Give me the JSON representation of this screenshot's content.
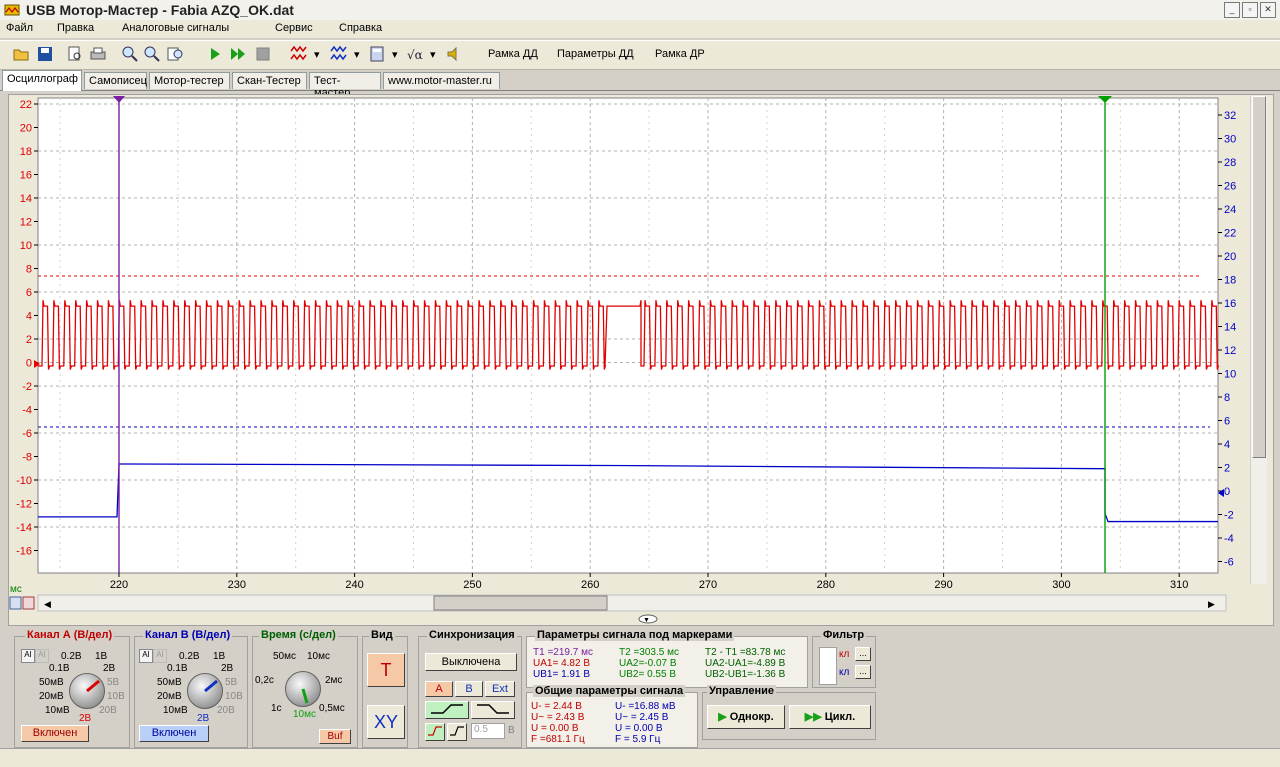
{
  "window": {
    "title": "USB Мотор-Мастер - Fabia AZQ_OK.dat",
    "controls": [
      "_",
      "▫",
      "✕"
    ]
  },
  "menu": [
    "Файл",
    "Правка",
    "Аналоговые сигналы",
    "Сервис",
    "Справка"
  ],
  "toolbar": {
    "frame_dd": "Рамка ДД",
    "params_dd": "Параметры ДД",
    "frame_dr": "Рамка ДР"
  },
  "tabs": [
    "Осциллограф",
    "Самописец",
    "Мотор-тестер",
    "Скан-Тестер",
    "Тест-мастер",
    "www.motor-master.ru"
  ],
  "scope": {
    "left_axis": [
      "22",
      "20",
      "18",
      "16",
      "14",
      "12",
      "10",
      "8",
      "6",
      "4",
      "2",
      "0",
      "-2",
      "-4",
      "-6",
      "-8",
      "-10",
      "-12",
      "-14",
      "-16"
    ],
    "right_axis": [
      "32",
      "30",
      "28",
      "26",
      "24",
      "22",
      "20",
      "18",
      "16",
      "14",
      "12",
      "10",
      "8",
      "6",
      "4",
      "2",
      "0",
      "-2",
      "-4",
      "-6"
    ],
    "time_axis": [
      "220",
      "230",
      "240",
      "250",
      "260",
      "270",
      "280",
      "290",
      "300",
      "310"
    ],
    "time_unit": "мс",
    "colors": {
      "chA": "#e00000",
      "chB": "#0000c8",
      "marker1": "#7a1fa0",
      "marker2": "#00a000"
    }
  },
  "chanA": {
    "title": "Канал А (В/дел)",
    "scales": [
      "0.2В",
      "1В",
      "0.1В",
      "2В",
      "50мВ",
      "5В",
      "20мВ",
      "10В",
      "10мВ",
      "20В"
    ],
    "current": "2В",
    "state": "Включен"
  },
  "chanB": {
    "title": "Канал В (В/дел)",
    "scales": [
      "0.2В",
      "1В",
      "0.1В",
      "2В",
      "50мВ",
      "5В",
      "20мВ",
      "10В",
      "10мВ",
      "20В"
    ],
    "current": "2В",
    "state": "Включен"
  },
  "time": {
    "title": "Время (с/дел)",
    "scales": [
      "50мс",
      "10мс",
      "0,2с",
      "2мс",
      "1с",
      "0,5мс"
    ],
    "current": "10мс",
    "buf": "Buf"
  },
  "view": {
    "title": "Вид",
    "t": "T",
    "xy": "XY"
  },
  "sync": {
    "title": "Синхронизация",
    "off": "Выключена",
    "a": "A",
    "b": "B",
    "ext": "Ext",
    "level": "0.5",
    "unit": "В"
  },
  "marker_params": {
    "title": "Параметры сигнала под маркерами",
    "col1": [
      "T1 =219.7 мс",
      "UA1= 4.82 В",
      "UB1= 1.91 В"
    ],
    "col2": [
      "T2 =303.5 мс",
      "UA2=-0.07 В",
      "UB2= 0.55 В"
    ],
    "col3": [
      "T2 - T1 =83.78 мс",
      "UA2-UA1=-4.89 В",
      "UB2-UB1=-1.36 В"
    ]
  },
  "general_params": {
    "title": "Общие параметры сигнала",
    "colA": [
      "U- = 2.44 В",
      "U~ = 2.43 В",
      "U = 0.00 В",
      "F =681.1 Гц"
    ],
    "colB": [
      "U- =16.88 мВ",
      "U~ = 2.45 В",
      "U = 0.00 В",
      "F = 5.9 Гц"
    ]
  },
  "filter": {
    "title": "Фильтр",
    "k1": "кл",
    "k2": "кл"
  },
  "control": {
    "title": "Управление",
    "single": "Однокр.",
    "cycle": "Цикл."
  }
}
